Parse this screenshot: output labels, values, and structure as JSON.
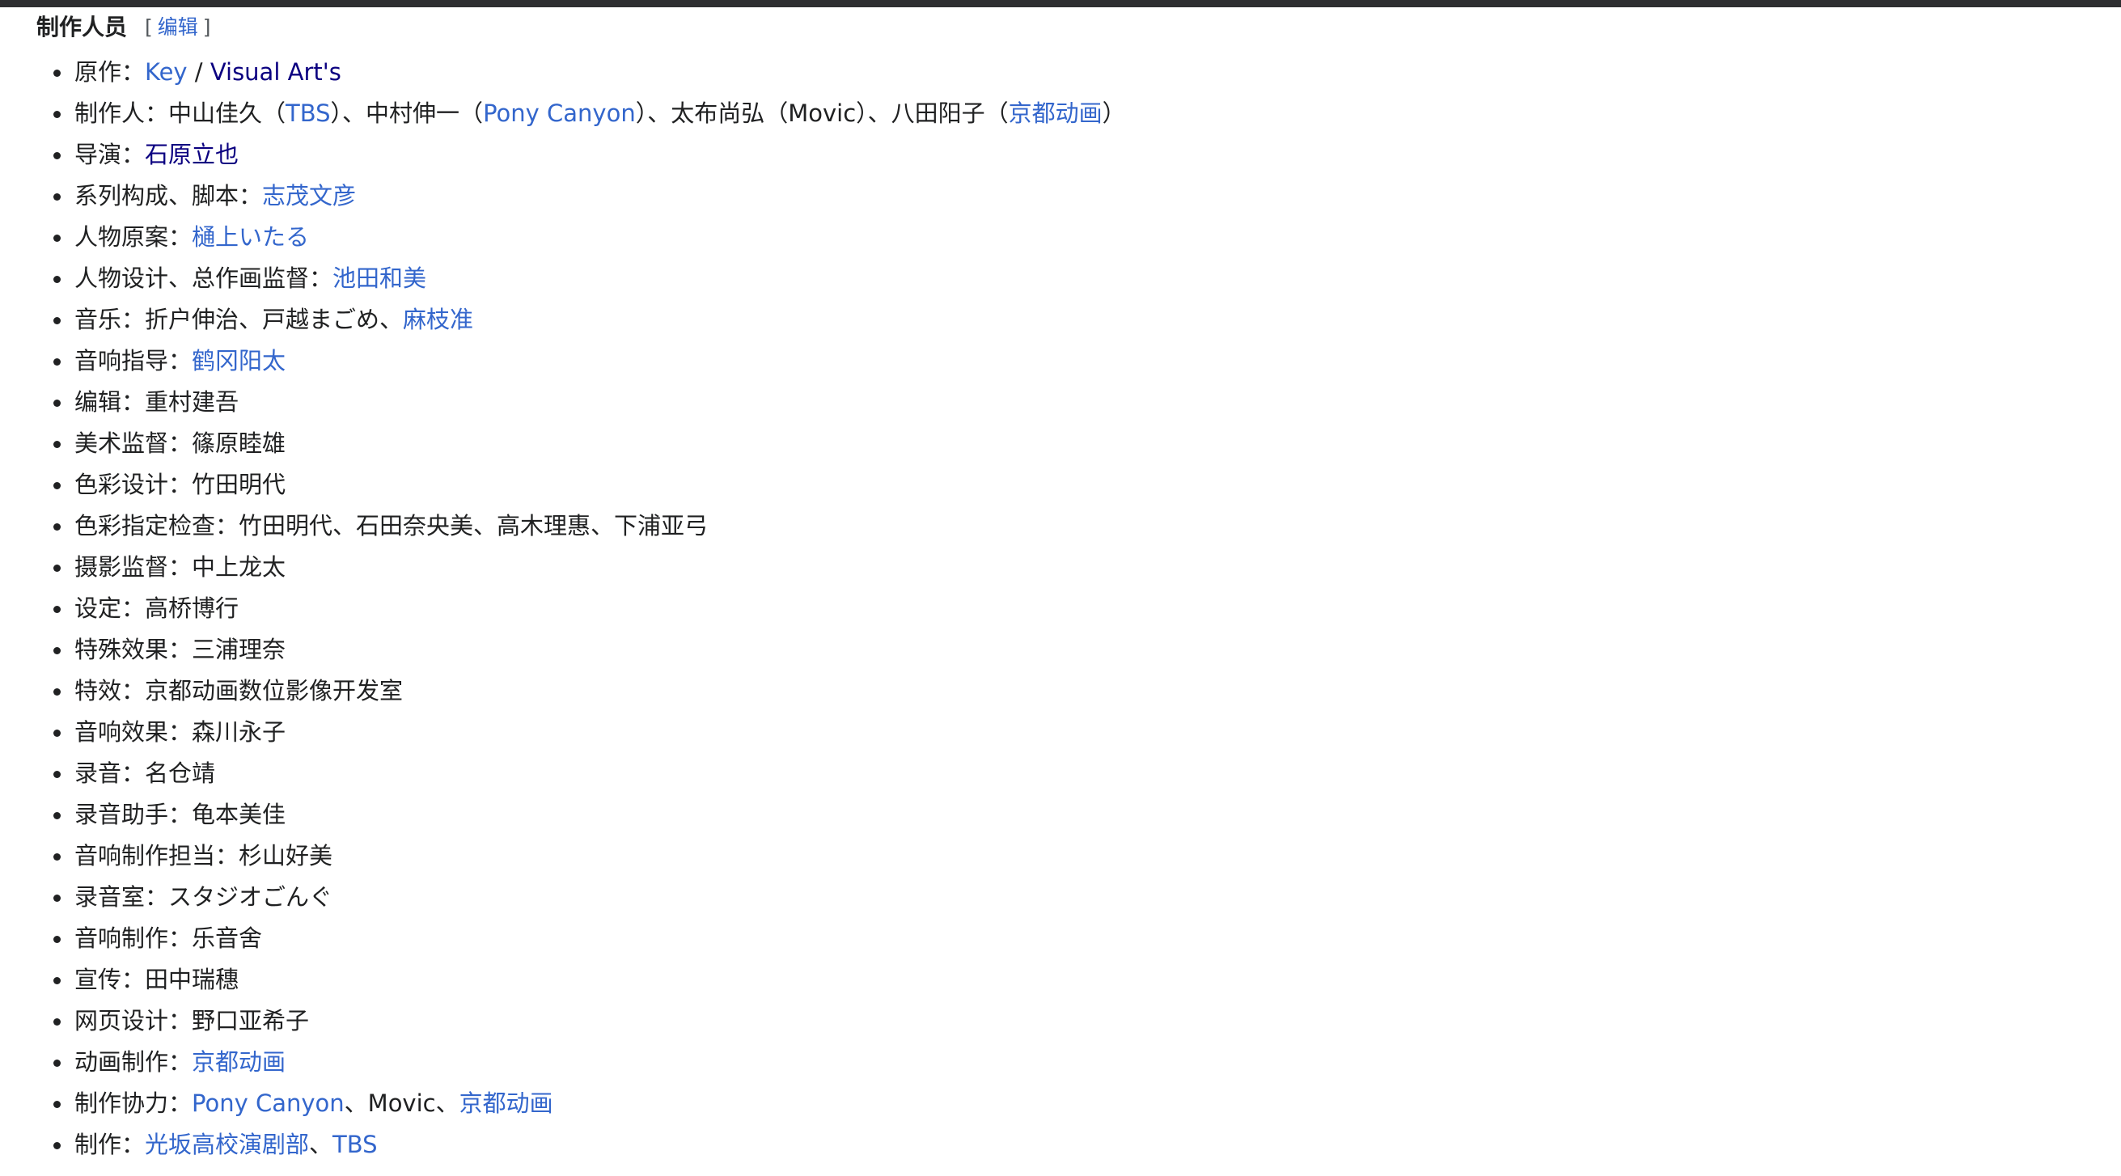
{
  "section": {
    "title": "制作人员",
    "edit_open": "[",
    "edit_label": "编辑",
    "edit_close": "]"
  },
  "credits": [
    {
      "role": "原作：",
      "parts": [
        {
          "t": "Key",
          "link": true
        },
        {
          "t": " / "
        },
        {
          "t": "Visual Art's",
          "link": true,
          "visited": true
        }
      ]
    },
    {
      "role": "制作人：",
      "parts": [
        {
          "t": "中山佳久（"
        },
        {
          "t": "TBS",
          "link": true
        },
        {
          "t": "）、中村伸一（"
        },
        {
          "t": "Pony Canyon",
          "link": true
        },
        {
          "t": "）、太布尚弘（Movic）、八田阳子（"
        },
        {
          "t": "京都动画",
          "link": true
        },
        {
          "t": "）"
        }
      ]
    },
    {
      "role": "导演：",
      "parts": [
        {
          "t": "石原立也",
          "link": true,
          "visited": true
        }
      ]
    },
    {
      "role": "系列构成、脚本：",
      "parts": [
        {
          "t": "志茂文彦",
          "link": true
        }
      ]
    },
    {
      "role": "人物原案：",
      "parts": [
        {
          "t": "樋上いたる",
          "link": true
        }
      ]
    },
    {
      "role": "人物设计、总作画监督：",
      "parts": [
        {
          "t": "池田和美",
          "link": true
        }
      ]
    },
    {
      "role": "音乐：",
      "parts": [
        {
          "t": "折户伸治、戸越まごめ、"
        },
        {
          "t": "麻枝准",
          "link": true
        }
      ]
    },
    {
      "role": "音响指导：",
      "parts": [
        {
          "t": "鹤冈阳太",
          "link": true
        }
      ]
    },
    {
      "role": "编辑：",
      "parts": [
        {
          "t": "重村建吾"
        }
      ]
    },
    {
      "role": "美术监督：",
      "parts": [
        {
          "t": "篠原睦雄"
        }
      ]
    },
    {
      "role": "色彩设计：",
      "parts": [
        {
          "t": "竹田明代"
        }
      ]
    },
    {
      "role": "色彩指定检查：",
      "parts": [
        {
          "t": "竹田明代、石田奈央美、高木理惠、下浦亚弓"
        }
      ]
    },
    {
      "role": "摄影监督：",
      "parts": [
        {
          "t": "中上龙太"
        }
      ]
    },
    {
      "role": "设定：",
      "parts": [
        {
          "t": "高桥博行"
        }
      ]
    },
    {
      "role": "特殊效果：",
      "parts": [
        {
          "t": "三浦理奈"
        }
      ]
    },
    {
      "role": "特效：",
      "parts": [
        {
          "t": "京都动画数位影像开发室"
        }
      ]
    },
    {
      "role": "音响效果：",
      "parts": [
        {
          "t": "森川永子"
        }
      ]
    },
    {
      "role": "录音：",
      "parts": [
        {
          "t": "名仓靖"
        }
      ]
    },
    {
      "role": "录音助手：",
      "parts": [
        {
          "t": "龟本美佳"
        }
      ]
    },
    {
      "role": "音响制作担当：",
      "parts": [
        {
          "t": "杉山好美"
        }
      ]
    },
    {
      "role": "录音室：",
      "parts": [
        {
          "t": "スタジオごんぐ"
        }
      ]
    },
    {
      "role": "音响制作：",
      "parts": [
        {
          "t": "乐音舍"
        }
      ]
    },
    {
      "role": "宣传：",
      "parts": [
        {
          "t": "田中瑞穗"
        }
      ]
    },
    {
      "role": "网页设计：",
      "parts": [
        {
          "t": "野口亚希子"
        }
      ]
    },
    {
      "role": "动画制作：",
      "parts": [
        {
          "t": "京都动画",
          "link": true
        }
      ]
    },
    {
      "role": "制作协力：",
      "parts": [
        {
          "t": "Pony Canyon",
          "link": true
        },
        {
          "t": "、Movic、"
        },
        {
          "t": "京都动画",
          "link": true
        }
      ]
    },
    {
      "role": "制作：",
      "parts": [
        {
          "t": "光坂高校演剧部",
          "link": true
        },
        {
          "t": "、"
        },
        {
          "t": "TBS",
          "link": true
        }
      ]
    }
  ],
  "colors": {
    "link": "#3366cc",
    "visited_link": "#0b0080",
    "text": "#202122",
    "top_bar": "#2e2f31"
  }
}
